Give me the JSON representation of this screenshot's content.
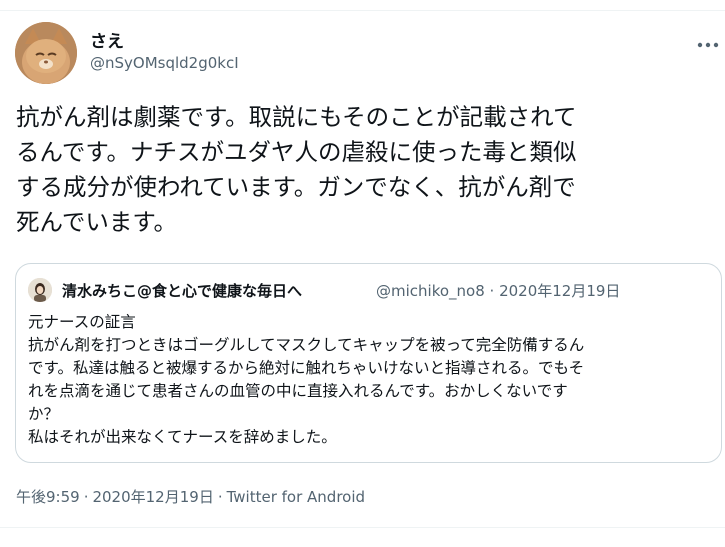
{
  "author": {
    "display_name": "さえ",
    "handle": "@nSyOMsqld2g0kcI"
  },
  "tweet": {
    "lines": [
      "抗がん剤は劇薬です。取説にもそのことが記載されて",
      "るんです。ナチスがユダヤ人の虐殺に使った毒と類似",
      "する成分が使われています。ガンでなく、抗がん剤で",
      "死んでいます。"
    ]
  },
  "quoted": {
    "display_name": "清水みちこ@食と心で健康な毎日へ",
    "handle": "@michiko_no8",
    "date": "2020年12月19日",
    "lines": [
      "元ナースの証言",
      "抗がん剤を打つときはゴーグルしてマスクしてキャップを被って完全防備するん",
      "です。私達は触ると被爆するから絶対に触れちゃいけないと指導される。でもそ",
      "れを点滴を通じて患者さんの血管の中に直接入れるんです。おかしくないです",
      "か？",
      "私はそれが出来なくてナースを辞めました。"
    ]
  },
  "meta": {
    "time": "午後9:59",
    "date": "2020年12月19日",
    "source": "Twitter for Android"
  },
  "icons": {
    "more": "more-horizontal-icon"
  }
}
